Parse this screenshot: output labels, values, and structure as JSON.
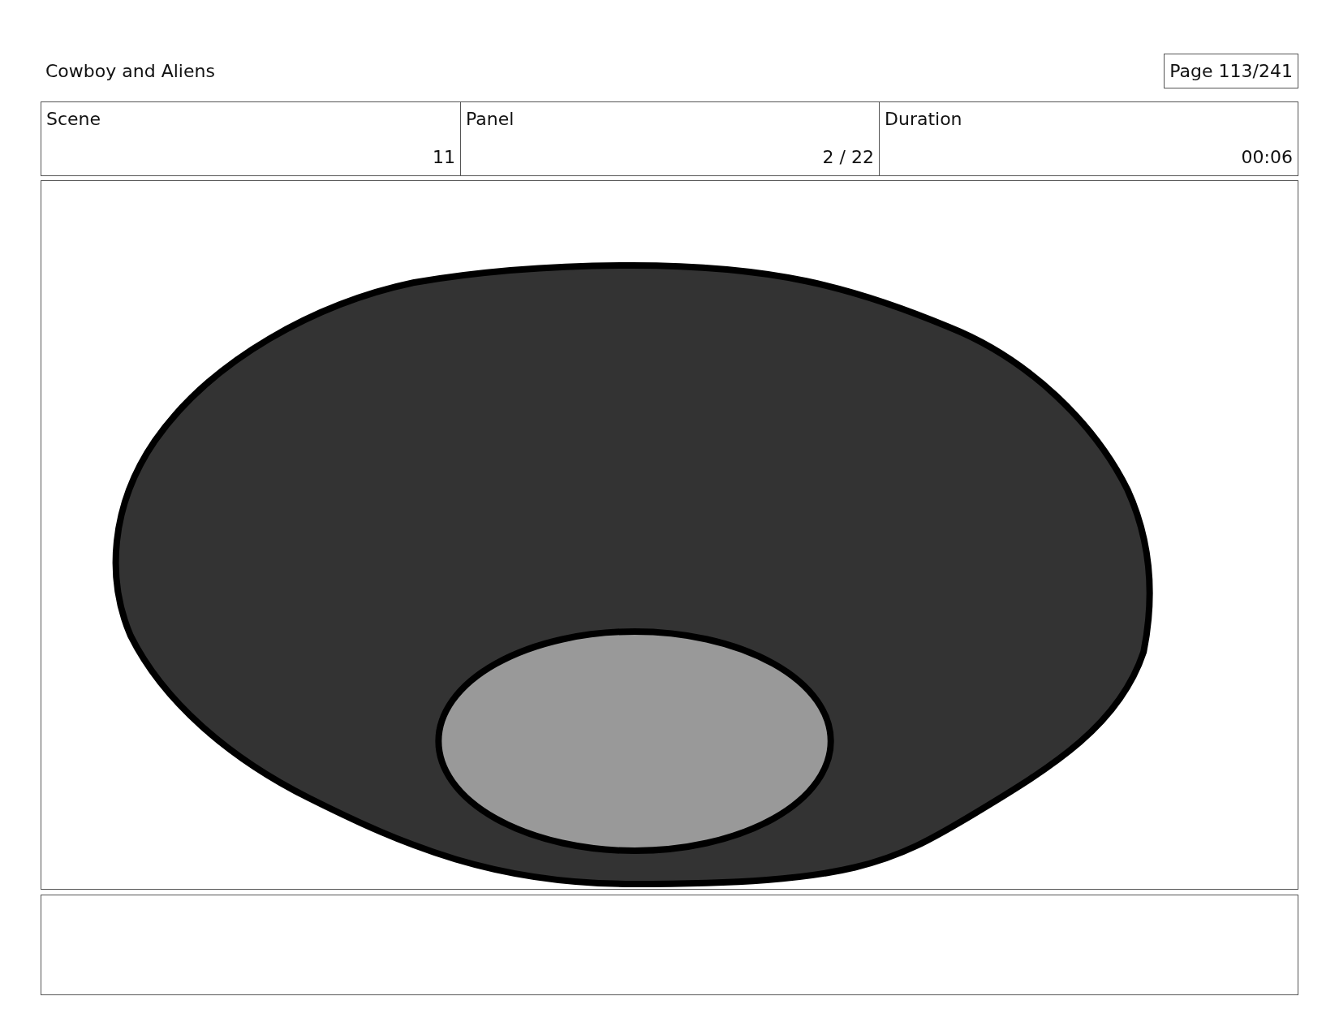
{
  "title": "Cowboy and Aliens",
  "page": "Page 113/241",
  "info_table": {
    "columns": [
      "Scene",
      "Panel",
      "Duration"
    ],
    "row": [
      "11",
      "2 / 22",
      "00:06"
    ]
  }
}
